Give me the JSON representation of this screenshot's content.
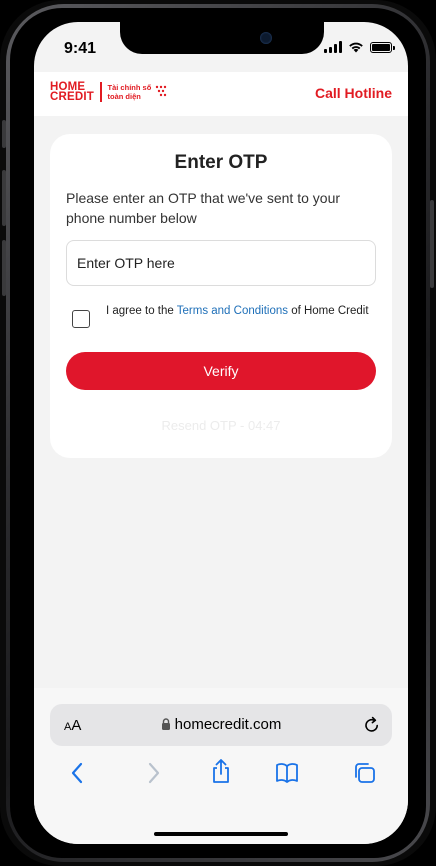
{
  "status_bar": {
    "time": "9:41"
  },
  "header": {
    "logo_line1": "HOME",
    "logo_line2": "CREDIT",
    "logo_tag_line1": "Tài chính số",
    "logo_tag_line2": "toàn diện",
    "hotline_label": "Call Hotline"
  },
  "otp_card": {
    "title": "Enter OTP",
    "description": "Please enter an OTP that we've sent to your phone number below",
    "input_placeholder": "Enter OTP here",
    "agree_prefix": "I agree to the ",
    "terms_link": "Terms and Conditions",
    "agree_suffix": " of Home Credit",
    "checkbox_checked": false,
    "verify_label": "Verify",
    "resend_label": "Resend OTP - 04:47"
  },
  "browser": {
    "text_size_label_small": "A",
    "text_size_label_large": "A",
    "url": "homecredit.com",
    "toolbar_icons": [
      "back-icon",
      "forward-icon",
      "share-icon",
      "bookmarks-icon",
      "tabs-icon"
    ]
  },
  "colors": {
    "brand_red": "#e11b22",
    "button_red": "#e0162b",
    "link_blue": "#1e6fb8",
    "toolbar_blue": "#1a73e8"
  }
}
